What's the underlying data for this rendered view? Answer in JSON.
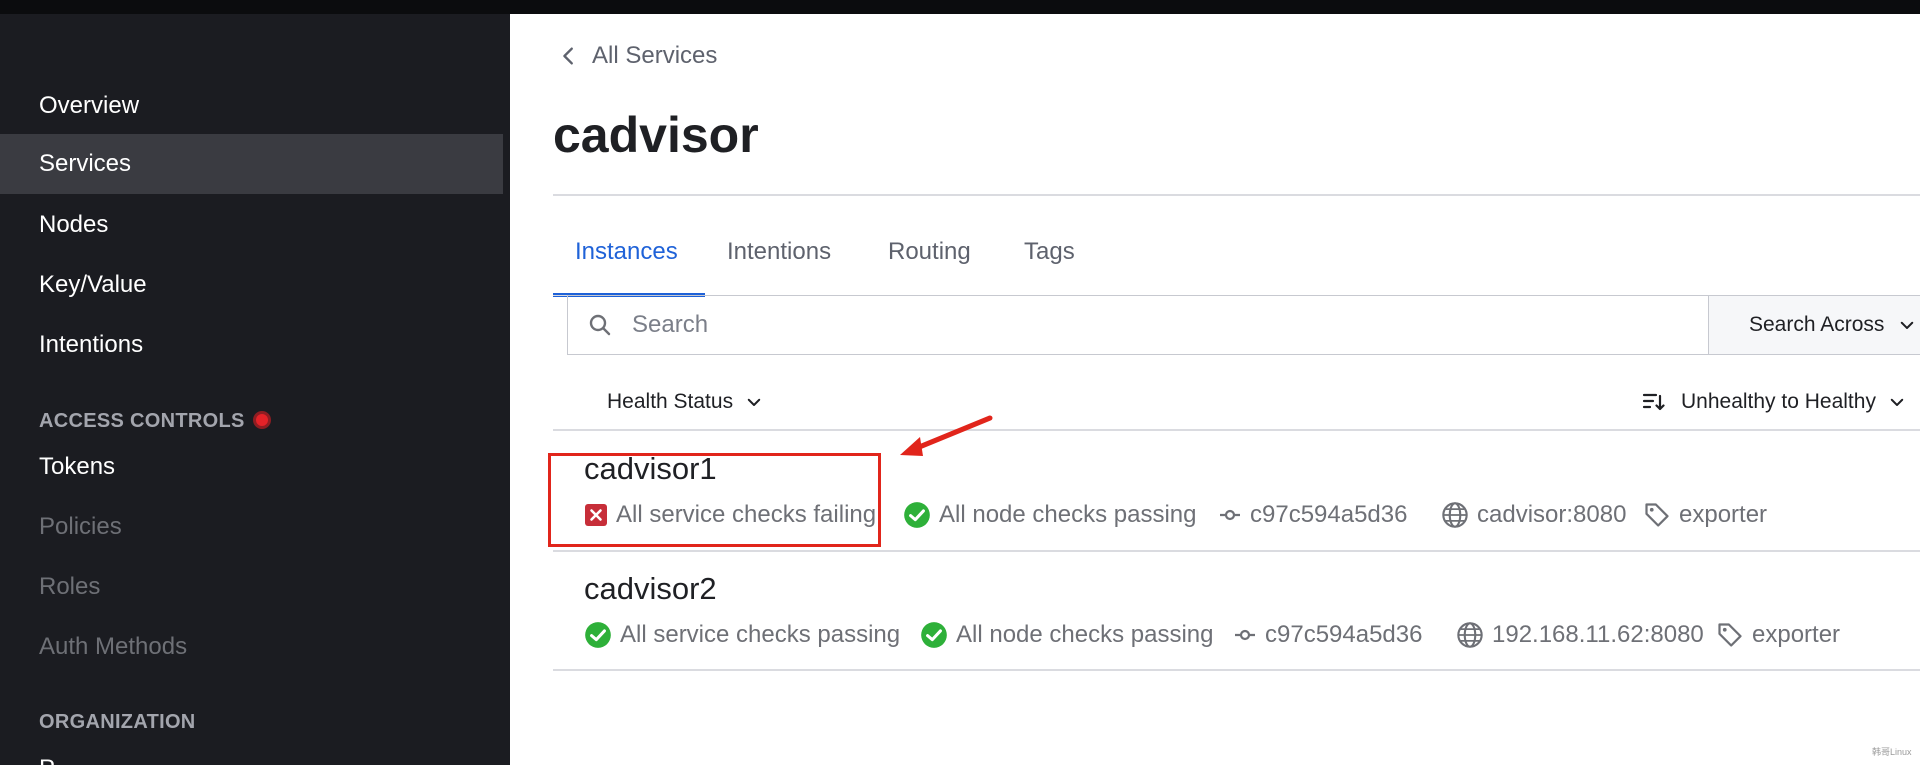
{
  "sidebar": {
    "items": [
      {
        "label": "Overview"
      },
      {
        "label": "Services"
      },
      {
        "label": "Nodes"
      },
      {
        "label": "Key/Value"
      },
      {
        "label": "Intentions"
      }
    ],
    "access_controls": {
      "label": "ACCESS CONTROLS",
      "items": [
        {
          "label": "Tokens"
        },
        {
          "label": "Policies"
        },
        {
          "label": "Roles"
        },
        {
          "label": "Auth Methods"
        }
      ]
    },
    "organization": {
      "label": "ORGANIZATION",
      "cut_item": "P"
    },
    "active_item": "Services"
  },
  "header": {
    "back_label": "All Services",
    "title": "cadvisor"
  },
  "tabs": [
    {
      "label": "Instances",
      "active": true
    },
    {
      "label": "Intentions"
    },
    {
      "label": "Routing"
    },
    {
      "label": "Tags"
    }
  ],
  "search": {
    "placeholder": "Search",
    "value": "",
    "across_label": "Search Across"
  },
  "filters": {
    "health_status_label": "Health Status",
    "sort_label": "Unhealthy to Healthy"
  },
  "instances": [
    {
      "name": "cadvisor1",
      "service_checks": "All service checks failing",
      "service_status": "failing",
      "node_checks": "All node checks passing",
      "commit": "c97c594a5d36",
      "address": "cadvisor:8080",
      "tag": "exporter"
    },
    {
      "name": "cadvisor2",
      "service_checks": "All service checks passing",
      "service_status": "passing",
      "node_checks": "All node checks passing",
      "commit": "c97c594a5d36",
      "address": "192.168.11.62:8080",
      "tag": "exporter"
    }
  ],
  "watermark": "韩哥Linux",
  "colors": {
    "sidebar_bg": "#1b1c21",
    "sidebar_active": "#3a3b41",
    "accent_blue": "#1f62d8",
    "passing_green": "#2eb039",
    "failing_red": "#c72e39",
    "annotation_red": "#e1251b"
  }
}
